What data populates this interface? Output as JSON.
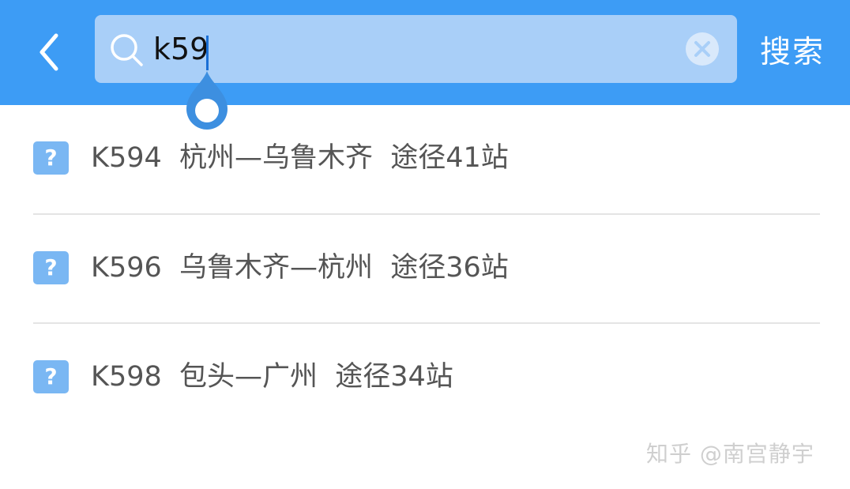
{
  "header": {
    "back_icon": "chevron-left-icon",
    "search": {
      "value": "k59",
      "placeholder": "",
      "icon": "search-icon",
      "clear_icon": "clear-icon"
    },
    "search_button_label": "搜索"
  },
  "results": [
    {
      "icon_label": "?",
      "text": "K594  杭州—乌鲁木齐  途径41站"
    },
    {
      "icon_label": "?",
      "text": "K596  乌鲁木齐—杭州  途径36站"
    },
    {
      "icon_label": "?",
      "text": "K598  包头—广州  途径34站"
    }
  ],
  "watermark": "知乎 @南宫静宇",
  "colors": {
    "header_bg": "#3d9cf5",
    "search_box_bg": "#a9cff8",
    "result_icon_bg": "#7ab7f3",
    "result_text": "#555555"
  }
}
